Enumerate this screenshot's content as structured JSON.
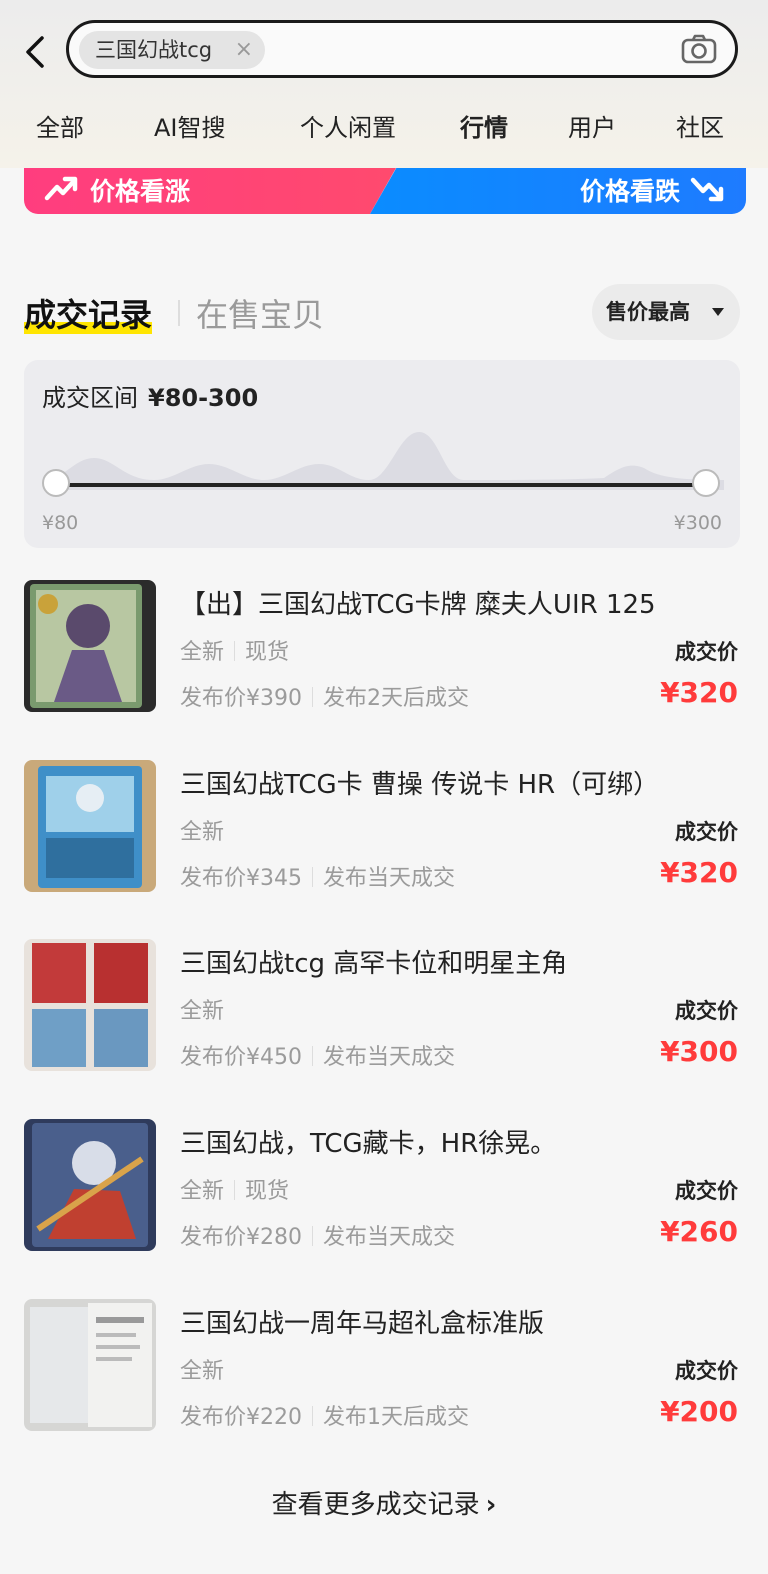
{
  "search": {
    "query": "三国幻战tcg",
    "clear_icon": "×"
  },
  "tabs": [
    {
      "label": "全部"
    },
    {
      "label": "AI智搜"
    },
    {
      "label": "个人闲置"
    },
    {
      "label": "行情",
      "active": true
    },
    {
      "label": "用户"
    },
    {
      "label": "社区"
    }
  ],
  "trend": {
    "up_label": "价格看涨",
    "down_label": "价格看跌",
    "up_color": "#ff3d7f",
    "down_color": "#0a8cff"
  },
  "section": {
    "records_tab": "成交记录",
    "onsale_tab": "在售宝贝",
    "sort_label": "售价最高"
  },
  "range": {
    "title": "成交区间",
    "value": "¥80-300",
    "min_label": "¥80",
    "max_label": "¥300"
  },
  "records": [
    {
      "title": "【出】三国幻战TCG卡牌 糜夫人UIR 125",
      "condition": "全新",
      "stock": "现货",
      "list_price": "发布价¥390",
      "sold_after": "发布2天后成交",
      "price_label": "成交价",
      "price": "¥320"
    },
    {
      "title": "三国幻战TCG卡 曹操 传说卡 HR（可绑）",
      "condition": "全新",
      "stock": "",
      "list_price": "发布价¥345",
      "sold_after": "发布当天成交",
      "price_label": "成交价",
      "price": "¥320"
    },
    {
      "title": "三国幻战tcg 高罕卡位和明星主角",
      "condition": "全新",
      "stock": "",
      "list_price": "发布价¥450",
      "sold_after": "发布当天成交",
      "price_label": "成交价",
      "price": "¥300"
    },
    {
      "title": "三国幻战，TCG藏卡，HR徐晃。",
      "condition": "全新",
      "stock": "现货",
      "list_price": "发布价¥280",
      "sold_after": "发布当天成交",
      "price_label": "成交价",
      "price": "¥260"
    },
    {
      "title": "三国幻战一周年马超礼盒标准版",
      "condition": "全新",
      "stock": "",
      "list_price": "发布价¥220",
      "sold_after": "发布1天后成交",
      "price_label": "成交价",
      "price": "¥200"
    }
  ],
  "more": {
    "label": "查看更多成交记录",
    "arrow": "›"
  },
  "colors": {
    "accent_yellow": "#ffe500",
    "price_red": "#ff3b3b"
  }
}
